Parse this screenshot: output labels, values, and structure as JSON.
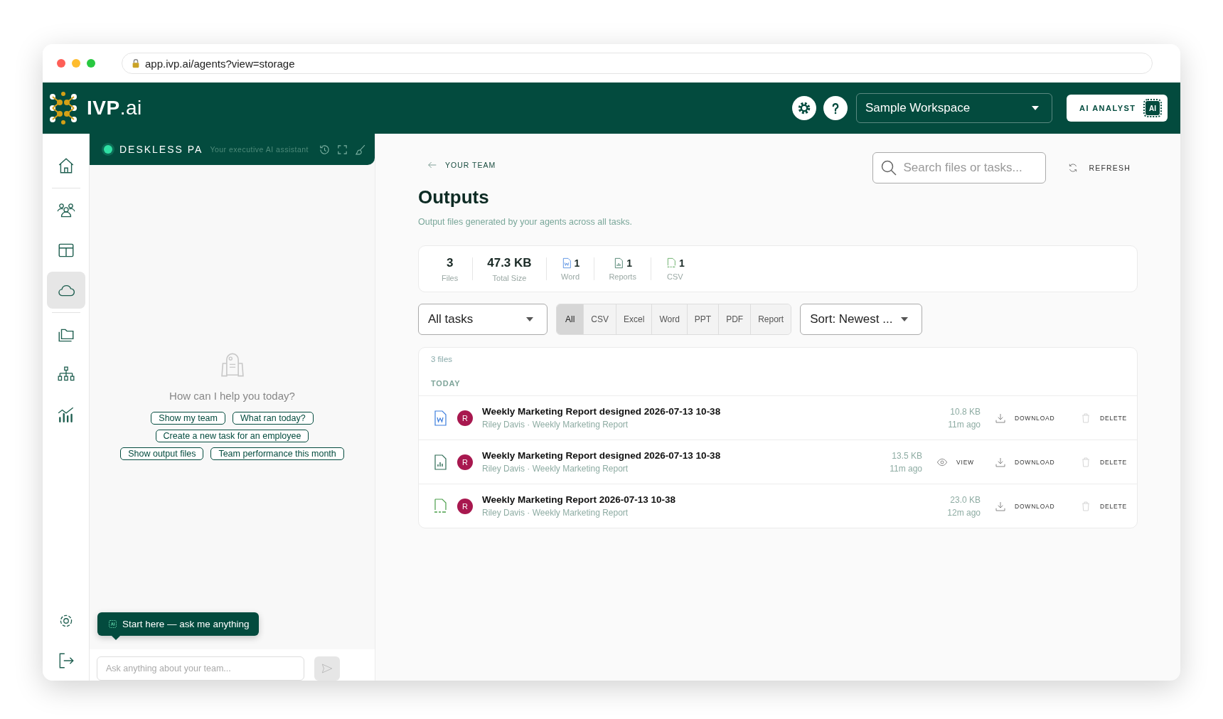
{
  "browser": {
    "url": "app.ivp.ai/agents?view=storage"
  },
  "header": {
    "brand": "**IVP**.ai",
    "workspace": "Sample Workspace",
    "ai_button": "AI ANALYST",
    "ai_chip": "AI"
  },
  "sidebar": {
    "groups": [
      [
        {
          "kind": "home",
          "selected": false
        }
      ],
      [
        {
          "kind": "team",
          "selected": false
        },
        {
          "kind": "layout",
          "selected": false
        },
        {
          "kind": "cloud",
          "selected": true
        }
      ],
      [
        {
          "kind": "folder",
          "selected": false
        },
        {
          "kind": "org",
          "selected": false
        },
        {
          "kind": "chart",
          "selected": false
        }
      ]
    ],
    "bottom": [
      {
        "kind": "settings",
        "selected": false
      },
      {
        "kind": "logout",
        "selected": false
      }
    ]
  },
  "assistant": {
    "name": "DESKLESS PA",
    "tagline": "Your executive AI assistant",
    "online": true,
    "prompt": "How can I help you today?",
    "suggestions": [
      [
        "Show my team",
        "What ran today?"
      ],
      [
        "Create a new task for an employee"
      ],
      [
        "Show output files",
        "Team performance this month"
      ]
    ],
    "tooltip": "Start here — ask me anything",
    "input": {
      "placeholder": "Ask anything about your team..."
    }
  },
  "main": {
    "back_link": "YOUR TEAM",
    "search": {
      "placeholder": "Search files or tasks..."
    },
    "refresh": "REFRESH",
    "title": "Outputs",
    "subtitle": "Output files generated by your agents across all tasks.",
    "stats": [
      {
        "kind": "plain",
        "value": "3",
        "label": "Files"
      },
      {
        "kind": "plain",
        "value": "47.3 KB",
        "label": "Total Size"
      },
      {
        "kind": "word",
        "value": "1",
        "label": "Word"
      },
      {
        "kind": "report",
        "value": "1",
        "label": "Reports"
      },
      {
        "kind": "csv",
        "value": "1",
        "label": "CSV"
      }
    ],
    "task_filter": "All tasks",
    "type_filters": [
      {
        "label": "All",
        "selected": true
      },
      {
        "label": "CSV",
        "selected": false
      },
      {
        "label": "Excel",
        "selected": false
      },
      {
        "label": "Word",
        "selected": false
      },
      {
        "label": "PPT",
        "selected": false
      },
      {
        "label": "PDF",
        "selected": false
      },
      {
        "label": "Report",
        "selected": false
      }
    ],
    "sort": "Sort: Newest ...",
    "files": {
      "count": "3 files",
      "group": "TODAY",
      "rows": [
        {
          "kind": "word",
          "avatar": "R",
          "title": "Weekly Marketing Report designed 2026-07-13 10-38",
          "meta": "Riley Davis · Weekly Marketing Report",
          "size": "10.8 KB",
          "age": "11m ago",
          "actions": [
            {
              "kind": "download",
              "label": "DOWNLOAD"
            },
            {
              "kind": "delete",
              "label": "DELETE"
            }
          ]
        },
        {
          "kind": "report",
          "avatar": "R",
          "title": "Weekly Marketing Report designed 2026-07-13 10-38",
          "meta": "Riley Davis · Weekly Marketing Report",
          "size": "13.5 KB",
          "age": "11m ago",
          "actions": [
            {
              "kind": "view",
              "label": "VIEW"
            },
            {
              "kind": "download",
              "label": "DOWNLOAD"
            },
            {
              "kind": "delete",
              "label": "DELETE"
            }
          ]
        },
        {
          "kind": "csv",
          "avatar": "R",
          "title": "Weekly Marketing Report 2026-07-13 10-38",
          "meta": "Riley Davis · Weekly Marketing Report",
          "size": "23.0 KB",
          "age": "12m ago",
          "actions": [
            {
              "kind": "download",
              "label": "DOWNLOAD"
            },
            {
              "kind": "delete",
              "label": "DELETE"
            }
          ]
        }
      ]
    }
  }
}
